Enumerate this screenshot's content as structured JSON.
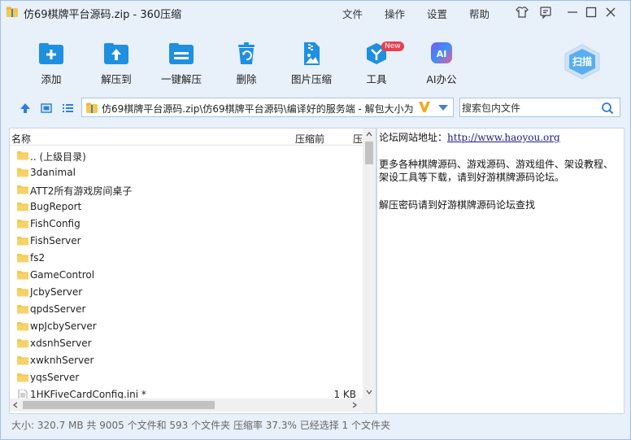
{
  "window": {
    "title": "仿69棋牌平台源码.zip - 360压缩",
    "menus": [
      "文件",
      "操作",
      "设置",
      "帮助"
    ]
  },
  "toolbar": {
    "items": [
      {
        "label": "添加",
        "icon": "add-icon"
      },
      {
        "label": "解压到",
        "icon": "extract-to-icon"
      },
      {
        "label": "一键解压",
        "icon": "one-click-extract-icon"
      },
      {
        "label": "删除",
        "icon": "trash-icon"
      },
      {
        "label": "图片压缩",
        "icon": "image-compress-icon"
      },
      {
        "label": "工具",
        "icon": "tools-icon"
      },
      {
        "label": "AI办公",
        "icon": "ai-icon"
      }
    ],
    "new_badge": "New",
    "ai_glyph": "AI",
    "scan_label": "扫描"
  },
  "address": {
    "path": "仿69棋牌平台源码.zip\\仿69棋牌平台源码\\编译好的服务端 - 解包大小为",
    "search_placeholder": "搜索包内文件"
  },
  "filelist": {
    "columns": [
      "名称",
      "压缩前",
      "压"
    ],
    "rows": [
      {
        "name": ".. (上级目录)",
        "type": "folder",
        "size": ""
      },
      {
        "name": "3danimal",
        "type": "folder",
        "size": ""
      },
      {
        "name": "ATT2所有游戏房间桌子",
        "type": "folder",
        "size": ""
      },
      {
        "name": "BugReport",
        "type": "folder",
        "size": ""
      },
      {
        "name": "FishConfig",
        "type": "folder",
        "size": ""
      },
      {
        "name": "FishServer",
        "type": "folder",
        "size": ""
      },
      {
        "name": "fs2",
        "type": "folder",
        "size": ""
      },
      {
        "name": "GameControl",
        "type": "folder",
        "size": ""
      },
      {
        "name": "JcbyServer",
        "type": "folder",
        "size": ""
      },
      {
        "name": "qpdsServer",
        "type": "folder",
        "size": ""
      },
      {
        "name": "wpJcbyServer",
        "type": "folder",
        "size": ""
      },
      {
        "name": "xdsnhServer",
        "type": "folder",
        "size": ""
      },
      {
        "name": "xwknhServer",
        "type": "folder",
        "size": ""
      },
      {
        "name": "yqsServer",
        "type": "folder",
        "size": ""
      },
      {
        "name": "1HKFiveCardConfig.ini *",
        "type": "file",
        "size": "1 KB"
      }
    ]
  },
  "info": {
    "forum_label": "论坛网站地址：",
    "forum_url": "http://www.haoyou.org",
    "line2": "更多各种棋牌源码、游戏源码、游戏组件、架设教程、",
    "line3": "架设工具等下载，请到好游棋牌源码论坛。",
    "line4": "解压密码请到好游棋牌源码论坛查找"
  },
  "status": "大小: 320.7 MB 共 9005 个文件和 593 个文件夹 压缩率 37.3% 已经选择 1 个文件夹",
  "colors": {
    "accent": "#1f8fe0",
    "background": "#e8f0fa",
    "folder": "#f5c84c"
  }
}
